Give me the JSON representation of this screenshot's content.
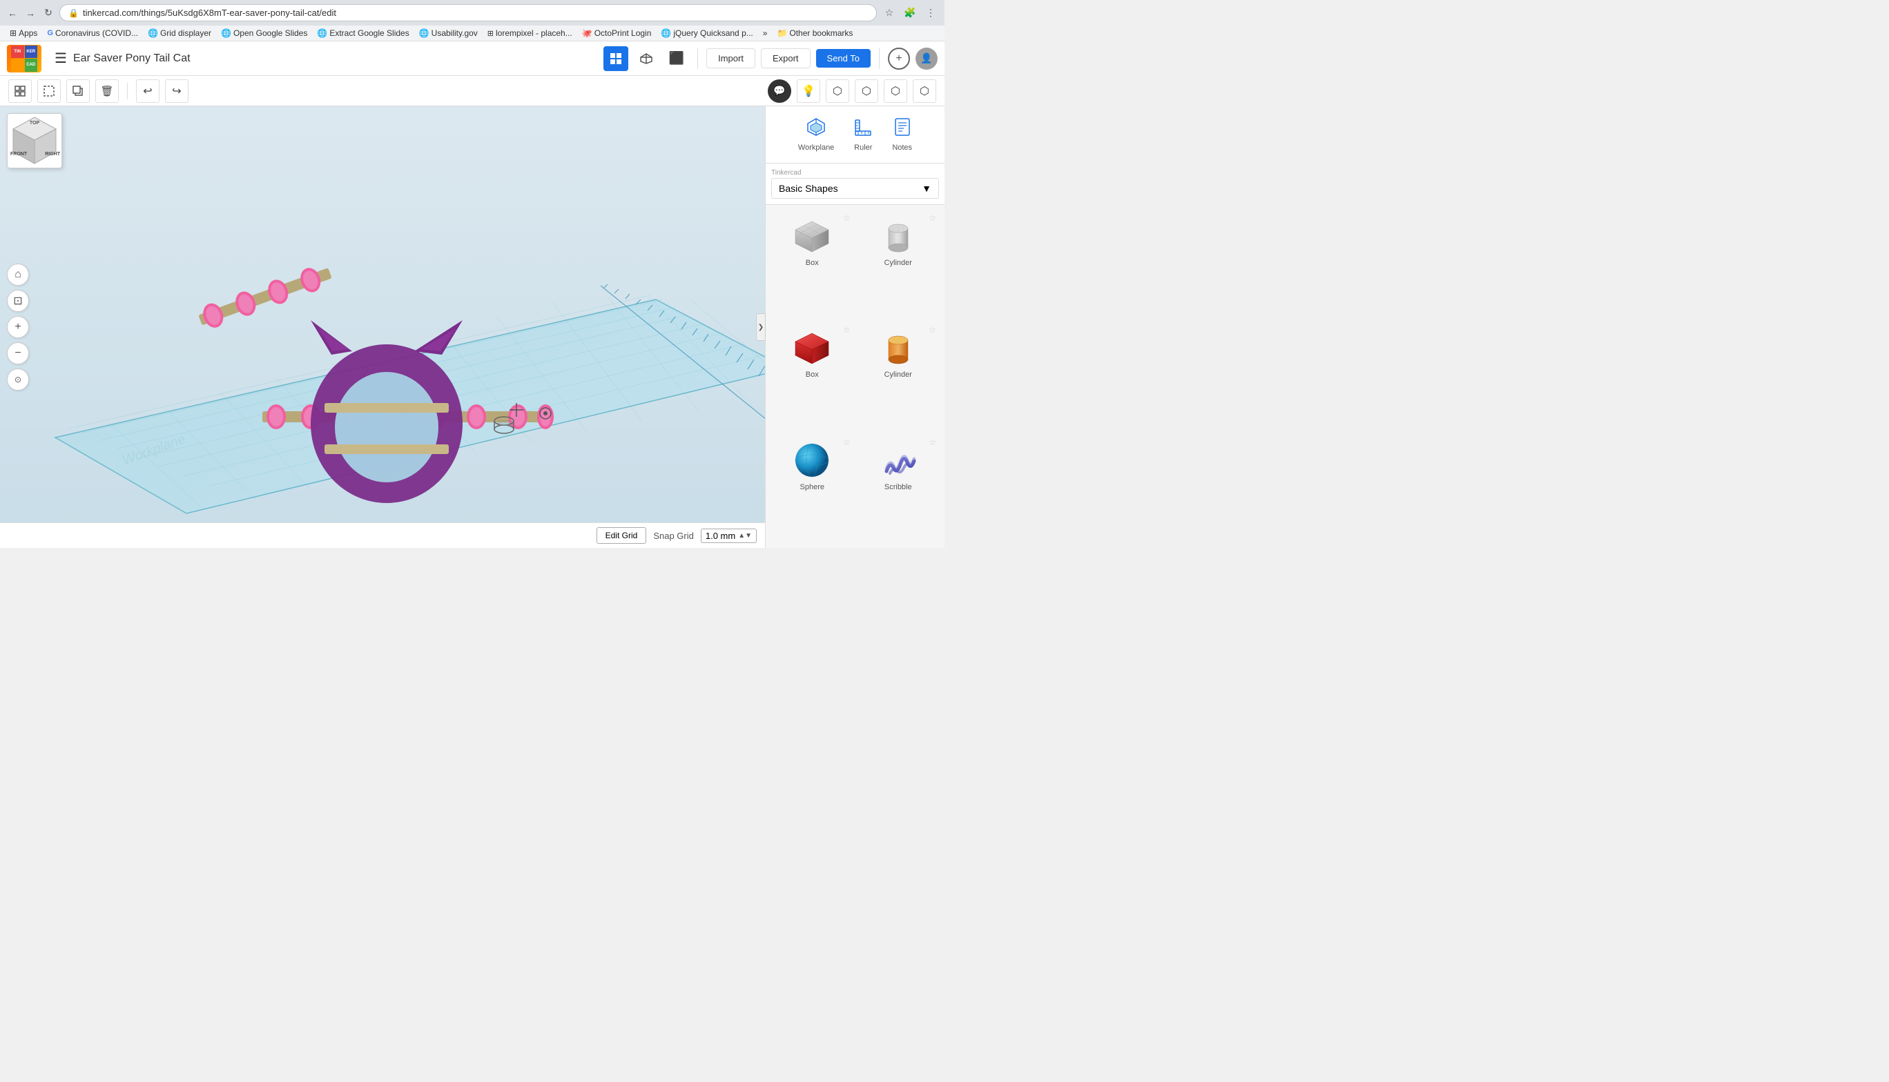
{
  "browser": {
    "url": "tinkercad.com/things/5uKsdg6X8mT-ear-saver-pony-tail-cat/edit",
    "back_btn": "←",
    "forward_btn": "→",
    "refresh_btn": "↺",
    "bookmarks": [
      {
        "label": "Apps",
        "icon": "grid"
      },
      {
        "label": "Coronavirus (COVID...",
        "icon": "google"
      },
      {
        "label": "Grid displayer",
        "icon": "globe"
      },
      {
        "label": "Open Google Slides",
        "icon": "globe"
      },
      {
        "label": "Extract Google Slides",
        "icon": "globe"
      },
      {
        "label": "Usability.gov",
        "icon": "globe"
      },
      {
        "label": "lorempixel - placeh...",
        "icon": "grid"
      },
      {
        "label": "OctoPrint Login",
        "icon": "octo"
      },
      {
        "label": "jQuery Quicksand p...",
        "icon": "globe"
      },
      {
        "label": "»",
        "icon": ""
      },
      {
        "label": "Other bookmarks",
        "icon": "folder"
      }
    ]
  },
  "header": {
    "title": "Ear Saver Pony Tail Cat",
    "hamburger": "☰",
    "actions": {
      "import": "Import",
      "export": "Export",
      "send_to": "Send To"
    }
  },
  "toolbar": {
    "group_btn": "⬜",
    "ungroup_btn": "⬜",
    "duplicate_btn": "⬜",
    "delete_btn": "🗑",
    "undo_btn": "↩",
    "redo_btn": "↪",
    "comment_btn": "💬",
    "light_btn": "💡",
    "shape_btn": "⬡",
    "mirror_btn": "⬡",
    "align_btn": "⬡",
    "flip_btn": "⬡"
  },
  "cube_nav": {
    "top": "TOP",
    "front": "FRONT",
    "right": "RIGHT"
  },
  "left_controls": {
    "home": "⌂",
    "fit": "⊡",
    "zoom_in": "+",
    "zoom_out": "−",
    "view3d": "◎"
  },
  "right_panel": {
    "tools": [
      {
        "label": "Workplane",
        "icon": "workplane"
      },
      {
        "label": "Ruler",
        "icon": "ruler"
      },
      {
        "label": "Notes",
        "icon": "notes"
      }
    ],
    "dropdown": {
      "provider": "Tinkercad",
      "value": "Basic Shapes"
    },
    "shapes": [
      {
        "name": "Box",
        "type": "box-gray",
        "row": 0
      },
      {
        "name": "Cylinder",
        "type": "cylinder-gray",
        "row": 0
      },
      {
        "name": "Box",
        "type": "box-red",
        "row": 1
      },
      {
        "name": "Cylinder",
        "type": "cylinder-orange",
        "row": 1
      },
      {
        "name": "Sphere",
        "type": "sphere-blue",
        "row": 2
      },
      {
        "name": "Scribble",
        "type": "scribble-blue",
        "row": 2
      }
    ]
  },
  "snap": {
    "edit_grid": "Edit Grid",
    "snap_grid": "Snap Grid",
    "value": "1.0 mm"
  },
  "collapse_handle": "❯"
}
